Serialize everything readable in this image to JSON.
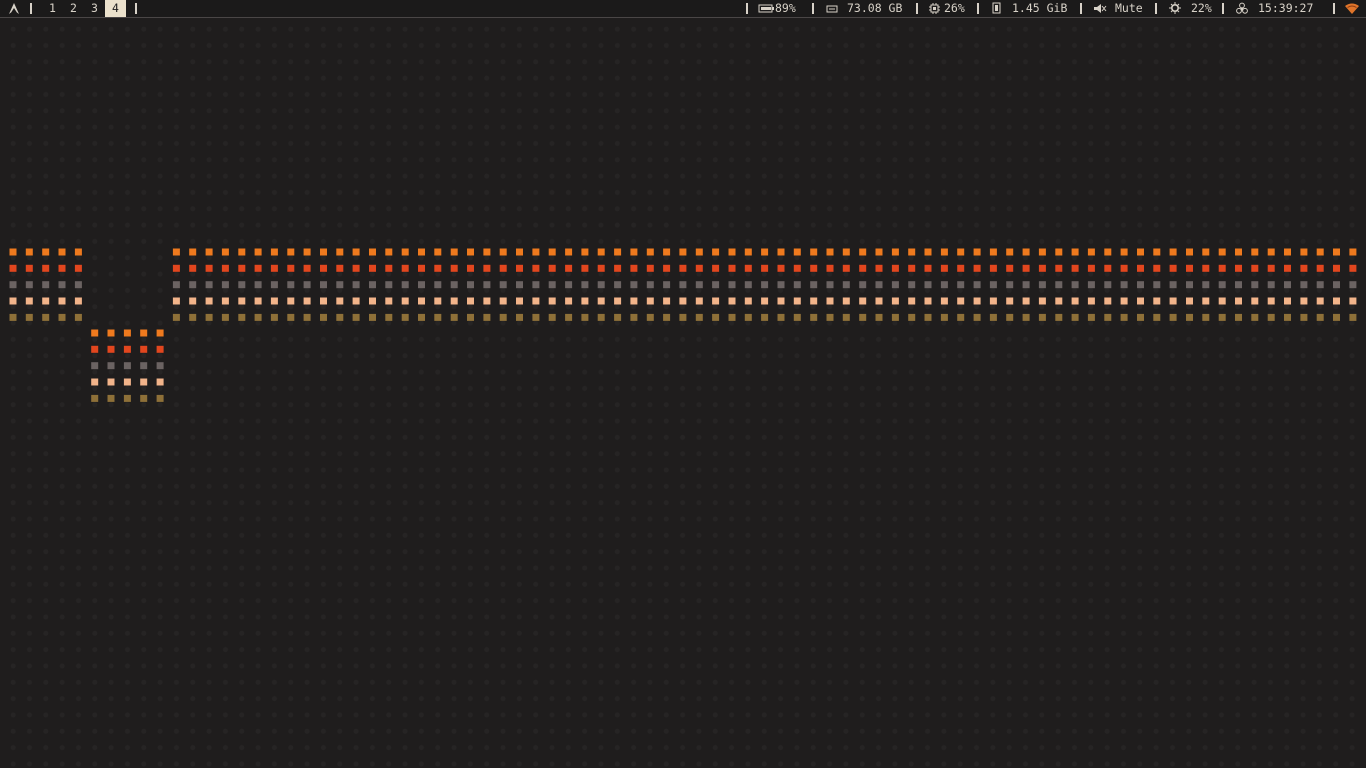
{
  "topbar": {
    "launcher_icon": "arch-logo-icon",
    "workspaces": [
      {
        "label": "1",
        "active": false
      },
      {
        "label": "2",
        "active": false
      },
      {
        "label": "3",
        "active": false
      },
      {
        "label": "4",
        "active": true
      }
    ],
    "status": {
      "battery": {
        "icon": "battery-icon",
        "value": "89%"
      },
      "disk": {
        "icon": "disk-icon",
        "value": "73.08 GB"
      },
      "cpu": {
        "icon": "cpu-icon",
        "value": "26%"
      },
      "memory": {
        "icon": "memory-icon",
        "value": "1.45 GiB"
      },
      "volume": {
        "icon": "speaker-muted-icon",
        "value": "Mute"
      },
      "brightness": {
        "icon": "brightness-icon",
        "value": "22%"
      },
      "clock": {
        "icon": "biohazard-icon",
        "value": "15:39:27"
      },
      "network": {
        "icon": "wifi-icon"
      }
    }
  },
  "palette": {
    "row_colors": [
      "#ef7a1e",
      "#e2461e",
      "#6b6362",
      "#f2b48a",
      "#8e7038"
    ],
    "background": "#1f1d1d",
    "bar_text": "#d8d2c8",
    "active_workspace_bg": "#ebe1cc"
  }
}
